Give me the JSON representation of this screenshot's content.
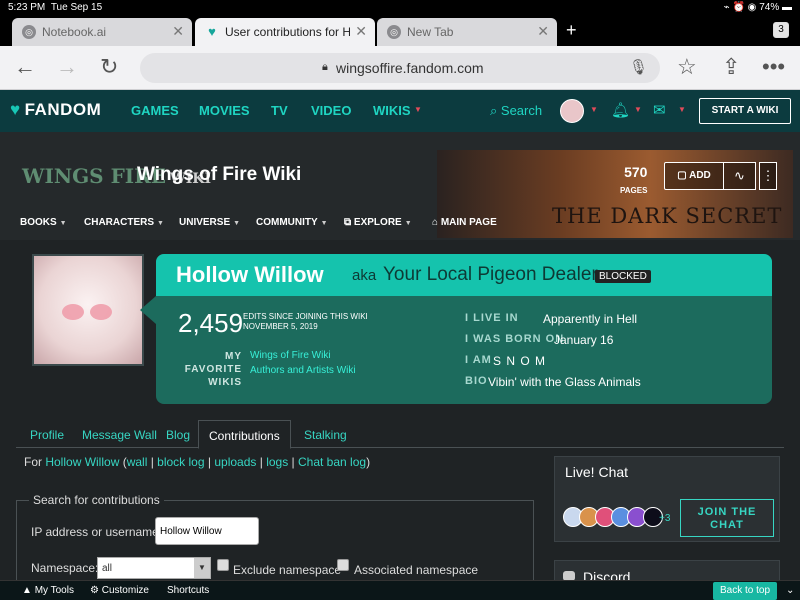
{
  "status_bar": {
    "time": "5:23 PM",
    "date": "Tue Sep 15",
    "battery": "74%"
  },
  "browser": {
    "tabs": [
      {
        "title": "Notebook.ai",
        "active": false
      },
      {
        "title": "User contributions for Ho",
        "active": true
      },
      {
        "title": "New Tab",
        "active": false
      }
    ],
    "tab_count": "3",
    "url": "wingsoffire.fandom.com"
  },
  "fandom_nav": {
    "logo": "FANDOM",
    "items": [
      "GAMES",
      "MOVIES",
      "TV",
      "VIDEO",
      "WIKIS"
    ],
    "search": "Search",
    "start_wiki": "START A WIKI"
  },
  "wiki": {
    "logo_main": "WINGS FIRE",
    "logo_suffix": "WIKI",
    "title": "Wings of Fire Wiki",
    "pages_count": "570",
    "pages_label": "PAGES",
    "add_label": "ADD",
    "banner_text": "THE DARK SECRET",
    "nav": [
      "BOOKS",
      "CHARACTERS",
      "UNIVERSE",
      "COMMUNITY",
      "EXPLORE",
      "MAIN PAGE"
    ]
  },
  "profile": {
    "username": "Hollow Willow",
    "aka_label": "aka",
    "aka": "Your Local Pigeon Dealer",
    "badge": "BLOCKED",
    "edits": "2,459",
    "edits_label_1": "EDITS SINCE JOINING THIS WIKI",
    "edits_label_2": "NOVEMBER 5, 2019",
    "fav_label": "MY FAVORITE WIKIS",
    "fav_wikis": [
      "Wings of Fire Wiki",
      "Authors and Artists Wiki"
    ],
    "fields": [
      {
        "label": "I LIVE IN",
        "value": "Apparently in Hell"
      },
      {
        "label": "I WAS BORN ON",
        "value": "January 16"
      },
      {
        "label": "I AM",
        "value": "S N O M"
      },
      {
        "label": "BIO",
        "value": "Vibin' with the Glass Animals"
      }
    ]
  },
  "profile_tabs": [
    "Profile",
    "Message Wall",
    "Blog",
    "Contributions",
    "Stalking"
  ],
  "contrib_line": {
    "prefix": "For",
    "user": "Hollow Willow",
    "links": [
      "wall",
      "block log",
      "uploads",
      "logs",
      "Chat ban log"
    ]
  },
  "search_form": {
    "legend": "Search for contributions",
    "ip_label": "IP address or username:",
    "ip_value": "Hollow Willow",
    "namespace_label": "Namespace:",
    "namespace_value": "all",
    "exclude_label": "Exclude namespace",
    "associated_label": "Associated namespace"
  },
  "live_chat": {
    "title": "Live! Chat",
    "more": "+3",
    "join": "JOIN THE CHAT"
  },
  "discord": {
    "title": "Discord"
  },
  "bottom_bar": {
    "my_tools": "My Tools",
    "customize": "Customize",
    "shortcuts": "Shortcuts",
    "back_to_top": "Back to top"
  },
  "colors": {
    "fandom_nav_bg": "#0c3b3f",
    "accent": "#1fd5c2",
    "profile_band": "#15c3ad",
    "profile_panel": "#1c6b5d"
  }
}
